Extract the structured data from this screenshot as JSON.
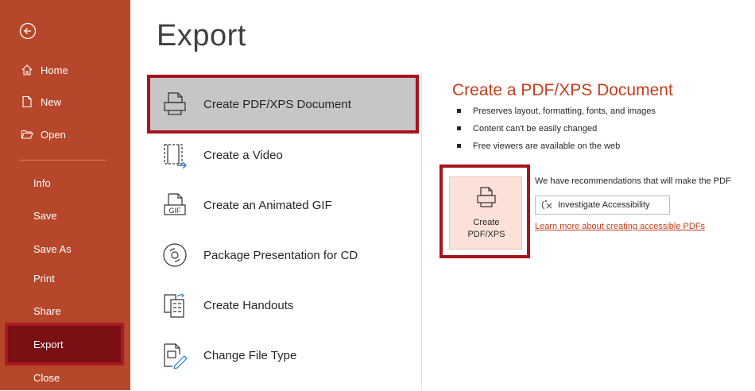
{
  "sidebar": {
    "back_icon": "back-arrow-icon",
    "top_items": [
      {
        "label": "Home",
        "icon": "home-icon"
      },
      {
        "label": "New",
        "icon": "new-document-icon"
      },
      {
        "label": "Open",
        "icon": "open-folder-icon"
      }
    ],
    "items": [
      "Info",
      "Save",
      "Save As",
      "Print",
      "Share",
      "Export",
      "Close"
    ],
    "selected": "Export"
  },
  "page": {
    "title": "Export"
  },
  "options": [
    {
      "label": "Create PDF/XPS Document",
      "icon": "pdf-document-icon",
      "selected": true
    },
    {
      "label": "Create a Video",
      "icon": "video-icon"
    },
    {
      "label": "Create an Animated GIF",
      "icon": "gif-icon"
    },
    {
      "label": "Package Presentation for CD",
      "icon": "cd-icon"
    },
    {
      "label": "Create Handouts",
      "icon": "handouts-icon"
    },
    {
      "label": "Change File Type",
      "icon": "change-file-type-icon"
    }
  ],
  "detail": {
    "title": "Create a PDF/XPS Document",
    "bullets": [
      "Preserves layout, formatting, fonts, and images",
      "Content can't be easily changed",
      "Free viewers are available on the web"
    ],
    "create_button": {
      "line1": "Create",
      "line2": "PDF/XPS"
    },
    "recommendation": "We have recommendations that will make the PDF",
    "investigate_label": "Investigate Accessibility",
    "learn_more": "Learn more about creating accessible PDFs"
  },
  "colors": {
    "sidebar_bg": "#b7472a",
    "export_selected_bg": "#7a0f14",
    "highlight_border": "#a8141c",
    "accent_text": "#c43e1c",
    "selected_option_bg": "#c6c6c6",
    "create_button_bg": "#fbe1d8"
  }
}
